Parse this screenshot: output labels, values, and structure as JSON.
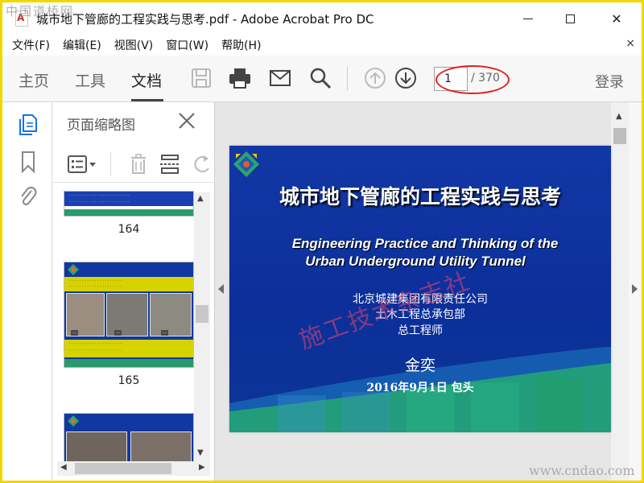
{
  "window": {
    "title": "城市地下管廊的工程实践与思考.pdf - Adobe Acrobat Pro DC",
    "watermark_top": "中国道桥网",
    "close_glyph": "✕"
  },
  "menu": {
    "items": [
      "文件(F)",
      "编辑(E)",
      "视图(V)",
      "窗口(W)",
      "帮助(H)"
    ],
    "close_glyph": "×"
  },
  "toolbar": {
    "tabs": [
      "主页",
      "工具",
      "文档"
    ],
    "active_tab": "文档",
    "current_page": "1",
    "total_pages": "/ 370",
    "login": "登录"
  },
  "thumbnails": {
    "title": "页面缩略图",
    "items": [
      {
        "label": "164"
      },
      {
        "label": "165"
      }
    ],
    "arrows": {
      "up": "▲",
      "down": "▼",
      "left": "◀",
      "right": "▶"
    }
  },
  "slide": {
    "title": "城市地下管廊的工程实践与思考",
    "en_line1": "Engineering Practice and Thinking of the",
    "en_line2": "Urban Underground Utility Tunnel",
    "org_line1": "北京城建集团有限责任公司",
    "org_line2": "土木工程总承包部",
    "org_line3": "总工程师",
    "name": "金奕",
    "date": "2016年9月1日    包头",
    "watermark": "施工技术杂志社"
  },
  "viewport": {
    "scroll_up": "▲"
  },
  "bottom_watermark": "www.cndao.com",
  "colors": {
    "accent_red": "#e02020",
    "slide_blue": "#1238a6",
    "frame_yellow": "#f2d600"
  }
}
